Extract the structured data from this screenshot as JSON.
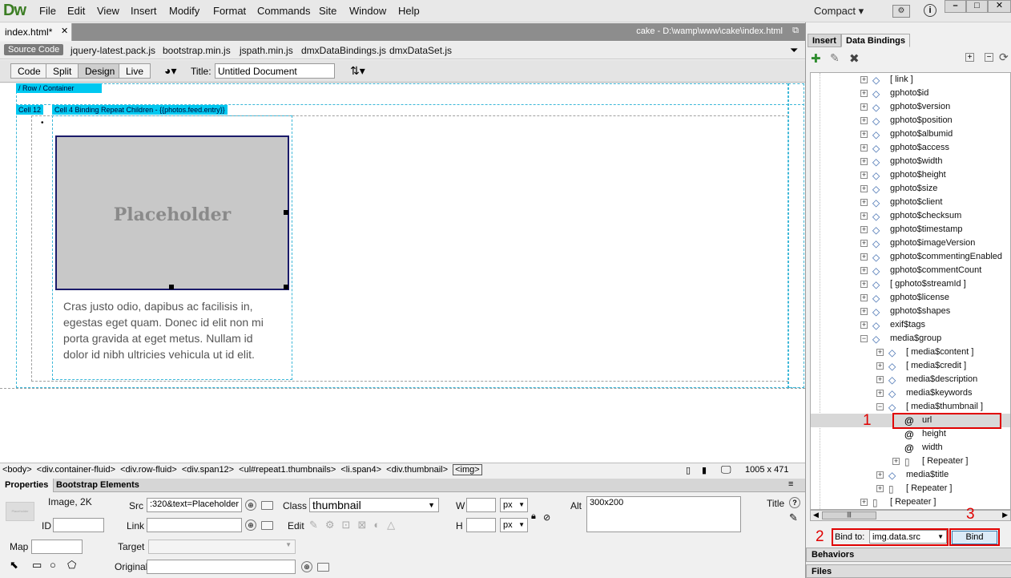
{
  "app": {
    "logo": "Dw",
    "menu": [
      "File",
      "Edit",
      "View",
      "Insert",
      "Modify",
      "Format",
      "Commands",
      "Site",
      "Window",
      "Help"
    ],
    "workspace": "Compact"
  },
  "document": {
    "tab": "index.html*",
    "path": "cake - D:\\wamp\\www\\cake\\index.html",
    "source_code_label": "Source Code",
    "related_files": [
      "jquery-latest.pack.js",
      "bootstrap.min.js",
      "jspath.min.js",
      "dmxDataBindings.js",
      "dmxDataSet.js"
    ],
    "views": [
      "Code",
      "Split",
      "Design",
      "Live"
    ],
    "title_label": "Title:",
    "title_value": "Untitled Document"
  },
  "design": {
    "row_label": "/ Row / Container",
    "cell12_label": "Cell 12",
    "cell4_label": "Cell 4 Binding Repeat Children - {{photos.feed.entry}}",
    "placeholder_text": "Placeholder",
    "caption": "Cras justo odio, dapibus ac facilisis in, egestas eget quam. Donec id elit non mi porta gravida at eget metus. Nullam id dolor id nibh ultricies vehicula ut id elit."
  },
  "tagbar": {
    "tags": [
      "<body>",
      "<div.container-fluid>",
      "<div.row-fluid>",
      "<div.span12>",
      "<ul#repeat1.thumbnails>",
      "<li.span4>",
      "<div.thumbnail>",
      "<img>"
    ],
    "size": "1005 x 471"
  },
  "properties": {
    "tabs": [
      "Properties",
      "Bootstrap Elements"
    ],
    "type": "Image, 2K",
    "thumb_text": "Placeholder",
    "id_label": "ID",
    "src_label": "Src",
    "src_value": ":320&text=Placeholder",
    "link_label": "Link",
    "class_label": "Class",
    "class_value": "thumbnail",
    "edit_label": "Edit",
    "w_label": "W",
    "h_label": "H",
    "unit": "px",
    "alt_label": "Alt",
    "alt_value": "300x200",
    "title_label": "Title",
    "map_label": "Map",
    "target_label": "Target",
    "original_label": "Original"
  },
  "panel": {
    "tabs": [
      "Insert",
      "Data Bindings"
    ],
    "tree": [
      {
        "label": "[ link ]",
        "indent": 0,
        "icon": "repeater-icon"
      },
      {
        "label": "gphoto$id",
        "indent": 0,
        "icon": "node-icon"
      },
      {
        "label": "gphoto$version",
        "indent": 0,
        "icon": "node-icon"
      },
      {
        "label": "gphoto$position",
        "indent": 0,
        "icon": "node-icon"
      },
      {
        "label": "gphoto$albumid",
        "indent": 0,
        "icon": "node-icon"
      },
      {
        "label": "gphoto$access",
        "indent": 0,
        "icon": "node-icon"
      },
      {
        "label": "gphoto$width",
        "indent": 0,
        "icon": "node-icon"
      },
      {
        "label": "gphoto$height",
        "indent": 0,
        "icon": "node-icon"
      },
      {
        "label": "gphoto$size",
        "indent": 0,
        "icon": "node-icon"
      },
      {
        "label": "gphoto$client",
        "indent": 0,
        "icon": "node-icon"
      },
      {
        "label": "gphoto$checksum",
        "indent": 0,
        "icon": "node-icon"
      },
      {
        "label": "gphoto$timestamp",
        "indent": 0,
        "icon": "node-icon"
      },
      {
        "label": "gphoto$imageVersion",
        "indent": 0,
        "icon": "node-icon"
      },
      {
        "label": "gphoto$commentingEnabled",
        "indent": 0,
        "icon": "node-icon"
      },
      {
        "label": "gphoto$commentCount",
        "indent": 0,
        "icon": "node-icon"
      },
      {
        "label": "[ gphoto$streamId ]",
        "indent": 0,
        "icon": "repeater-icon"
      },
      {
        "label": "gphoto$license",
        "indent": 0,
        "icon": "node-icon"
      },
      {
        "label": "gphoto$shapes",
        "indent": 0,
        "icon": "node-icon"
      },
      {
        "label": "exif$tags",
        "indent": 0,
        "icon": "node-icon"
      },
      {
        "label": "media$group",
        "indent": 0,
        "icon": "node-icon",
        "expanded": true
      },
      {
        "label": "[ media$content ]",
        "indent": 1,
        "icon": "repeater-icon"
      },
      {
        "label": "[ media$credit ]",
        "indent": 1,
        "icon": "repeater-icon"
      },
      {
        "label": "media$description",
        "indent": 1,
        "icon": "node-icon"
      },
      {
        "label": "media$keywords",
        "indent": 1,
        "icon": "node-icon"
      },
      {
        "label": "[ media$thumbnail ]",
        "indent": 1,
        "icon": "repeater-icon",
        "expanded": true
      },
      {
        "label": "url",
        "indent": 2,
        "icon": "at-icon",
        "selected": true
      },
      {
        "label": "height",
        "indent": 2,
        "icon": "at-icon"
      },
      {
        "label": "width",
        "indent": 2,
        "icon": "at-icon"
      },
      {
        "label": "[ Repeater ]",
        "indent": 2,
        "icon": "page-icon"
      },
      {
        "label": "media$title",
        "indent": 1,
        "icon": "node-icon"
      },
      {
        "label": "[ Repeater ]",
        "indent": 1,
        "icon": "page-icon"
      },
      {
        "label": "[ Repeater ]",
        "indent": 0,
        "icon": "page-icon"
      }
    ],
    "bind_to_label": "Bind to:",
    "bind_to_value": "img.data.src",
    "bind_button": "Bind",
    "annotations": [
      "1",
      "2",
      "3"
    ],
    "bottom_tabs": [
      "Behaviors",
      "Files"
    ]
  }
}
